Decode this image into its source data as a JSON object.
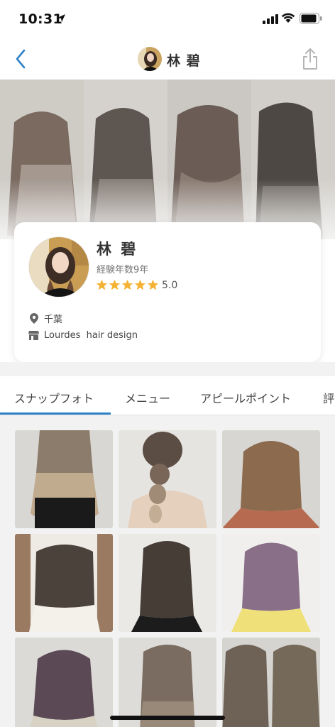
{
  "status_bar": {
    "time": "10:31",
    "icons": [
      "location-arrow-icon",
      "signal-bars-icon",
      "wifi-icon",
      "battery-icon"
    ]
  },
  "nav": {
    "title": "林 碧",
    "back_icon": "chevron-left-icon",
    "share_icon": "share-icon",
    "accent_color": "#2f81c8"
  },
  "profile": {
    "name": "林 碧",
    "experience": "経験年数9年",
    "rating": 5.0,
    "rating_text": "5.0",
    "stars": 5,
    "location": "千葉",
    "salon": "Lourdes  hair design",
    "star_color": "#f5b335"
  },
  "tabs": [
    {
      "label": "スナップフォト",
      "active": true
    },
    {
      "label": "メニュー",
      "active": false
    },
    {
      "label": "アピールポイント",
      "active": false
    },
    {
      "label": "評",
      "active": false
    }
  ],
  "photos": [
    {
      "name": "snap-photo-1"
    },
    {
      "name": "snap-photo-2"
    },
    {
      "name": "snap-photo-3"
    },
    {
      "name": "snap-photo-4"
    },
    {
      "name": "snap-photo-5"
    },
    {
      "name": "snap-photo-6"
    },
    {
      "name": "snap-photo-7"
    },
    {
      "name": "snap-photo-8"
    },
    {
      "name": "snap-photo-9"
    }
  ]
}
